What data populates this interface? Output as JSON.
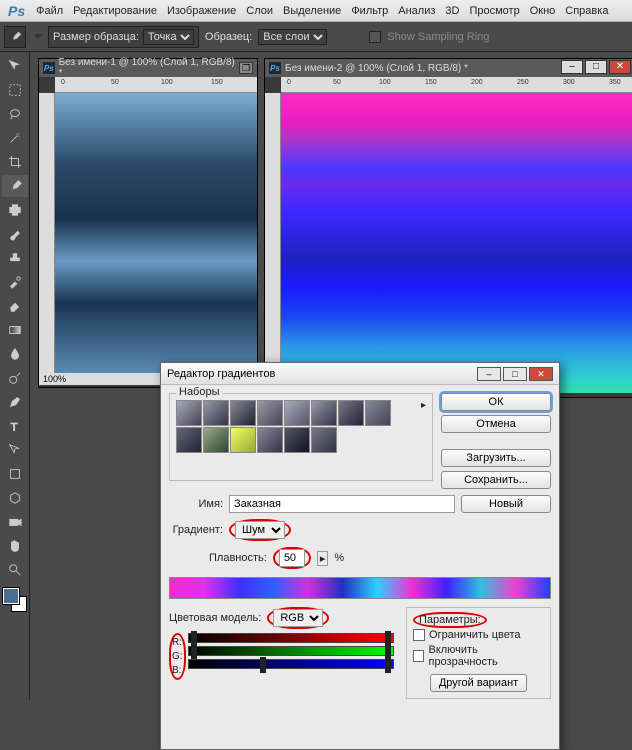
{
  "menubar": {
    "items": [
      "Файл",
      "Редактирование",
      "Изображение",
      "Слои",
      "Выделение",
      "Фильтр",
      "Анализ",
      "3D",
      "Просмотр",
      "Окно",
      "Справка"
    ]
  },
  "optbar": {
    "sample_size_label": "Размер образца:",
    "sample_size_value": "Точка",
    "sample_label": "Образец:",
    "sample_value": "Все слои",
    "show_ring": "Show Sampling Ring"
  },
  "doc1": {
    "title": "Без имени-1 @ 100% (Слой 1, RGB/8) *",
    "zoom": "100%",
    "ruler": [
      "0",
      "50",
      "100",
      "150"
    ]
  },
  "doc2": {
    "title": "Без имени-2 @ 100% (Слой 1, RGB/8) *",
    "ruler": [
      "0",
      "50",
      "100",
      "150",
      "200",
      "250",
      "300",
      "350"
    ]
  },
  "dialog": {
    "title": "Редактор градиентов",
    "presets_label": "Наборы",
    "buttons": {
      "ok": "ОК",
      "cancel": "Отмена",
      "load": "Загрузить...",
      "save": "Сохранить..."
    },
    "name_label": "Имя:",
    "name_value": "Заказная",
    "new": "Новый",
    "grad_label": "Градиент:",
    "grad_value": "Шум",
    "smooth_label": "Плавность:",
    "smooth_value": "50",
    "smooth_unit": "%",
    "cm_label": "Цветовая модель:",
    "cm_value": "RGB",
    "ch": {
      "r": "R:",
      "g": "G:",
      "b": "B:"
    },
    "params_label": "Параметры:",
    "limit": "Ограничить цвета",
    "trans": "Включить прозрачность",
    "other": "Другой вариант"
  }
}
